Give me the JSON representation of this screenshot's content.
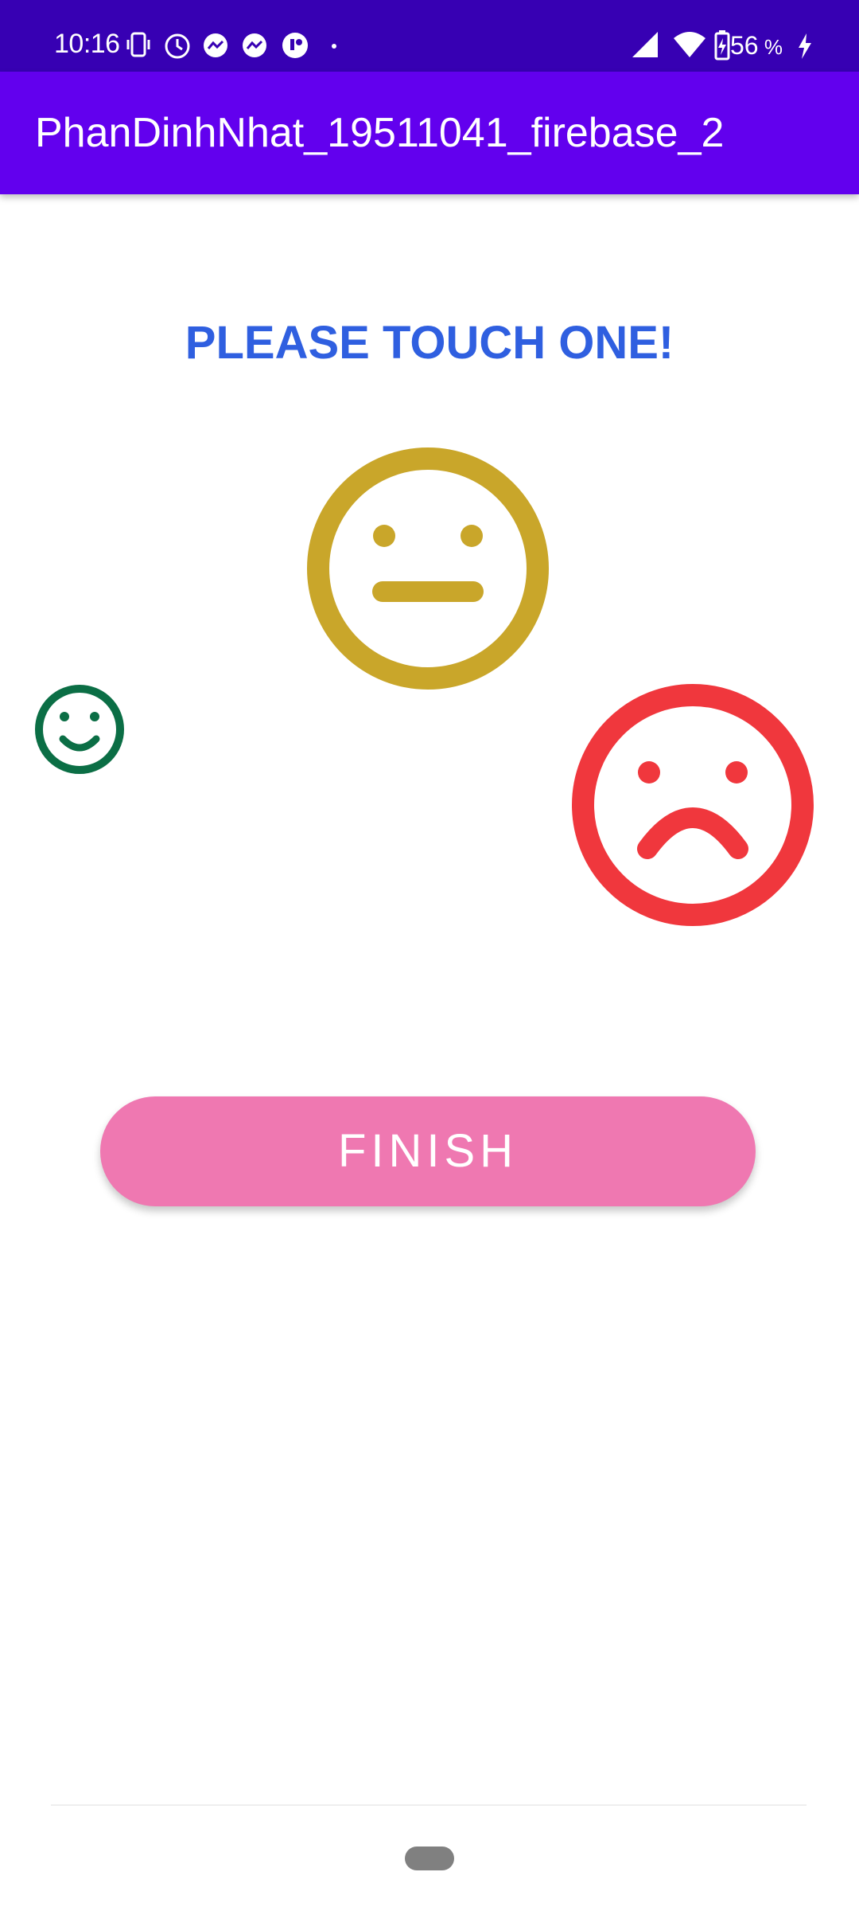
{
  "status_bar": {
    "time": "10:16",
    "battery_level": "56",
    "icons": [
      "vibrate-icon",
      "clock-icon",
      "messenger-icon",
      "messenger-icon",
      "app-icon",
      "dot-icon",
      "signal-icon",
      "wifi-icon",
      "battery-charging-icon",
      "charging-bolt-icon"
    ]
  },
  "app_bar": {
    "title": "PhanDinhNhat_19511041_firebase_2"
  },
  "main": {
    "prompt": "PLEASE TOUCH ONE!",
    "faces": [
      {
        "name": "neutral-face-icon",
        "color": "#c9a62a"
      },
      {
        "name": "happy-face-icon",
        "color": "#0b6e45"
      },
      {
        "name": "sad-face-icon",
        "color": "#f0373d"
      }
    ],
    "finish_label": "FINISH"
  },
  "colors": {
    "status_bar": "#3700b3",
    "app_bar": "#6200ee",
    "prompt_text": "#2f5fe0",
    "finish_button": "#ef78b1"
  }
}
